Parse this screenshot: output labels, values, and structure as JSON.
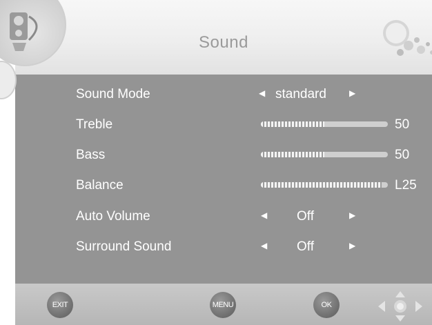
{
  "title": "Sound",
  "rows": [
    {
      "label": "Sound Mode",
      "value": "standard"
    },
    {
      "label": "Treble",
      "value": "50",
      "level": 0.5
    },
    {
      "label": "Bass",
      "value": "50",
      "level": 0.5
    },
    {
      "label": "Balance",
      "value": "L25",
      "level": 0.95
    },
    {
      "label": "Auto Volume",
      "value": "Off"
    },
    {
      "label": "Surround Sound",
      "value": "Off"
    }
  ],
  "buttons": {
    "exit": "EXIT",
    "menu": "MENU",
    "ok": "OK"
  },
  "icons": {
    "left_arrow": "triangle-left-icon",
    "right_arrow": "triangle-right-icon",
    "dpad": "dpad-icon",
    "logo": "speaker-logo-icon",
    "decoration": "bubbles-icon"
  },
  "colors": {
    "panel": "#949494",
    "title_band": "#eeeeee",
    "text": "#ffffff",
    "title_text": "#9a9a9a"
  }
}
